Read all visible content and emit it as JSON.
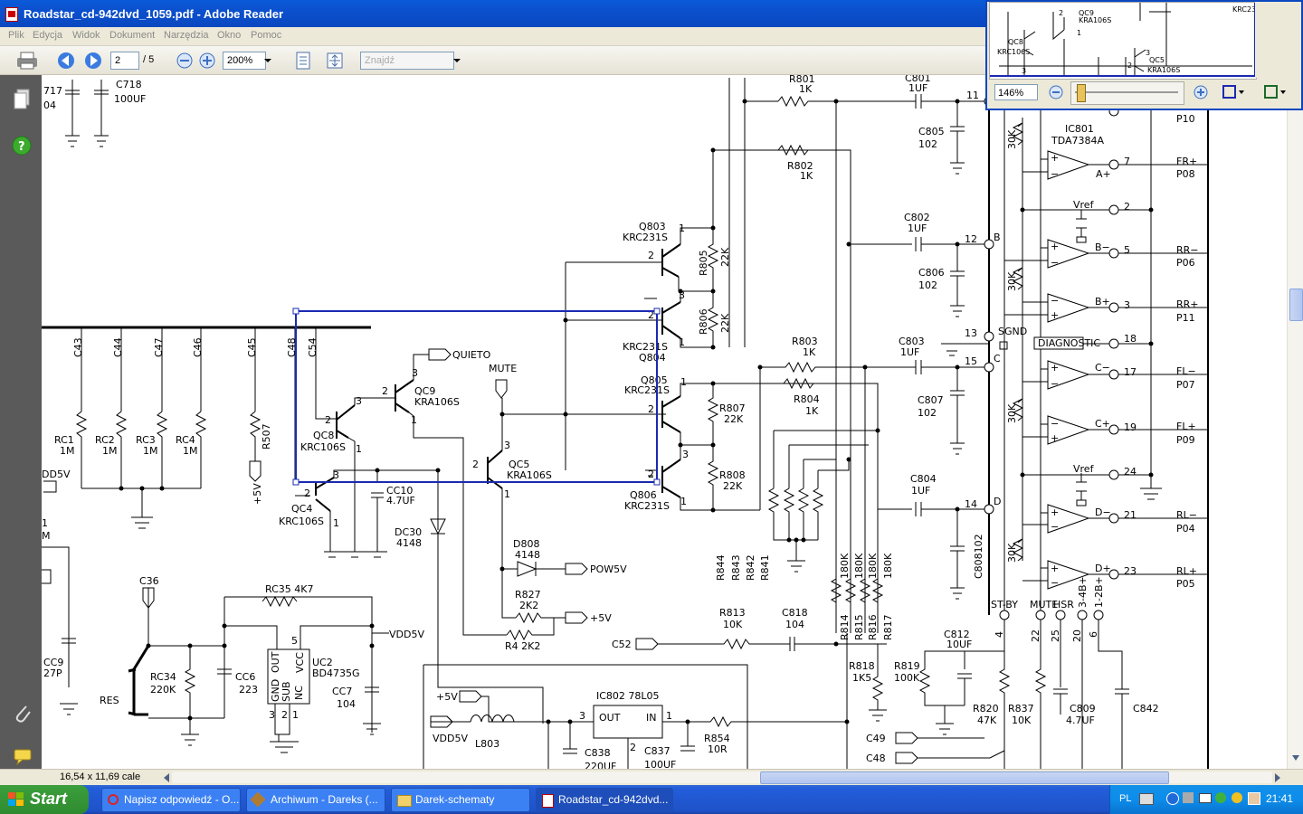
{
  "window": {
    "title": "Roadstar_cd-942dvd_1059.pdf - Adobe Reader"
  },
  "menu": [
    "Plik",
    "Edycja",
    "Widok",
    "Dokument",
    "Narzędzia",
    "Okno",
    "Pomoc"
  ],
  "toolbar": {
    "page_current": "2",
    "page_total": "/ 5",
    "zoom": "200%",
    "search_placeholder": "Znajdź"
  },
  "status": {
    "page_size": "16,54 x 11,69 cale"
  },
  "panzoom": {
    "zoom": "146%"
  },
  "taskbar": {
    "start": "Start",
    "tasks": [
      "Napisz odpowiedź - O...",
      "Archiwum - Dareks (...",
      "Darek-schematy",
      "Roadstar_cd-942dvd..."
    ],
    "language": "PL",
    "clock": "21:41"
  },
  "colors": {
    "titlebar": "#0b4fcc",
    "selection": "#1a2ab0",
    "taskbar": "#245edb",
    "start": "#2f8a2f"
  },
  "schematic": {
    "labels": {
      "c718": "C718",
      "c718_v": "100UF",
      "c717": "717",
      "c717_v": "04",
      "q803": "Q803",
      "q803_t": "KRC231S",
      "q804_t": "KRC231S",
      "q804": "Q804",
      "q805": "Q805",
      "q805_t": "KRC231S",
      "q806": "Q806",
      "q806_t": "KRC231S",
      "r805": "R805",
      "r805_v": "22K",
      "r806": "R806",
      "r806_v": "22K",
      "r807": "R807",
      "r807_v": "22K",
      "r808": "R808",
      "r808_v": "22K",
      "r801": "R801",
      "r801_v": "1K",
      "r802": "R802",
      "r802_v": "1K",
      "r803": "R803",
      "r803_v": "1K",
      "r804": "R804",
      "r804_v": "1K",
      "c801": "C801",
      "c801_v": "1UF",
      "c802": "C802",
      "c802_v": "1UF",
      "c803": "C803",
      "c803_v": "1UF",
      "c804": "C804",
      "c804_v": "1UF",
      "c805": "C805",
      "c805_v": "102",
      "c806": "C806",
      "c806_v": "102",
      "c807": "C807",
      "c807_v": "102",
      "c808": "C808102",
      "ic801": "IC801",
      "ic801_t": "TDA7384A",
      "qc9": "QC9",
      "qc9_t": "KRA106S",
      "qc8": "QC8",
      "qc8_t": "KRC106S",
      "qc5": "QC5",
      "qc5_t": "KRA106S",
      "qc4": "QC4",
      "qc4_t": "KRC106S",
      "quieto": "QUIETO",
      "mute": "MUTE",
      "pow5v": "POW5V",
      "p5v": "+5V",
      "cc10": "CC10",
      "cc10_v": "4.7UF",
      "dc30": "DC30",
      "dc30_v": "4148",
      "d808": "D808",
      "d808_v": "4148",
      "r827": "R827",
      "r827_v": "2K2",
      "r4": "R4  2K2",
      "c52": "C52",
      "r813": "R813",
      "r813_v": "10K",
      "c818": "C818",
      "c818_v": "104",
      "rc35": "RC35  4K7",
      "uc2": "UC2",
      "uc2_t": "BD4735G",
      "rc34": "RC34",
      "rc34_v": "220K",
      "cc6": "CC6",
      "cc6_v": "223",
      "cc7": "CC7",
      "cc7_v": "104",
      "vdd5v": "VDD5V",
      "res": "RES",
      "c36": "C36",
      "cc9": "CC9",
      "cc9_v": "27P",
      "ic802": "IC802  78L05",
      "out": "OUT",
      "in": "IN",
      "l803": "L803",
      "r854": "R854",
      "r854_v": "10R",
      "c838": "C838",
      "c838_v": "220UF",
      "c837": "C837",
      "c837_v": "100UF",
      "r818": "R818",
      "r818_v": "1K5",
      "r819": "R819",
      "r819_v": "100K",
      "c812": "C812",
      "c812_v": "10UF",
      "r820": "R820",
      "r820_v": "47K",
      "r837": "R837",
      "r837_v": "10K",
      "c809": "C809",
      "c809_v": "4.7UF",
      "c842": "C842",
      "c49": "C49",
      "c48": "C48",
      "stby": "ST-BY",
      "mutep": "MUTE",
      "hsr": "HSR",
      "p348": "3-4B+",
      "p128": "1-2B+",
      "diag": "DIAGNOSTIC",
      "sgnd": "SGND",
      "vref": "Vref",
      "fr_p": "FR+",
      "p08": "P08",
      "rr_m": "RR−",
      "p06": "P06",
      "rr_p": "RR+",
      "p11": "P11",
      "fl_m": "FL−",
      "p07": "P07",
      "fl_p": "FL+",
      "p09": "P09",
      "rl_m": "RL−",
      "p04": "P04",
      "rl_p": "RL+",
      "p05": "P05",
      "p10": "P10",
      "dd5v": "DD5V"
    }
  }
}
